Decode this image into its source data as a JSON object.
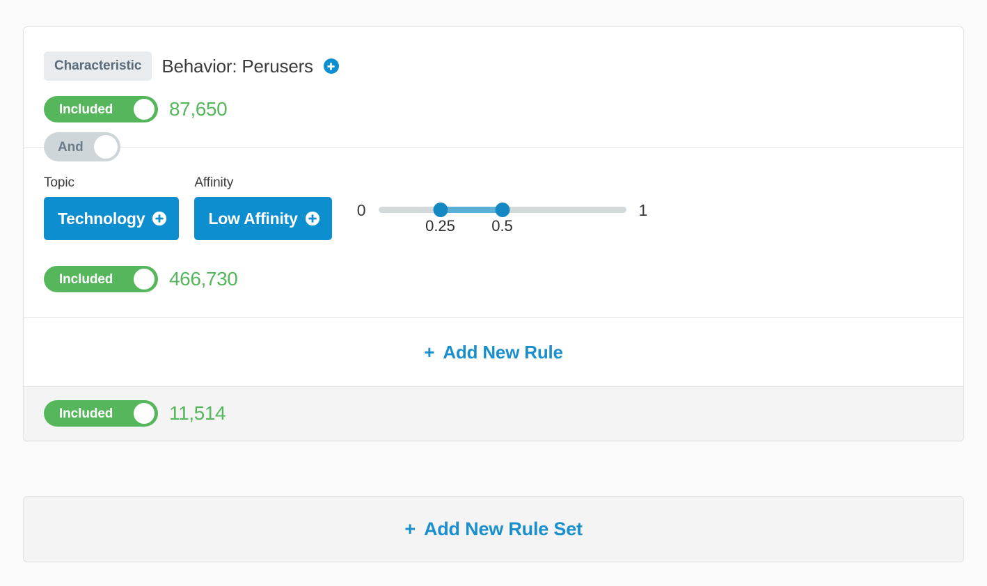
{
  "colors": {
    "page_bg": "#fafafa",
    "card_bg": "#ffffff",
    "card_border": "#dfe3e6",
    "accent_blue": "#0d8ecf",
    "link_blue": "#1a8fcc",
    "included_green": "#56b65b",
    "chip_gray": "#e8ecef",
    "and_gray": "#ced6da",
    "slider_track": "#d4d9dc",
    "slider_fill": "#5bb0d8",
    "slider_handle": "#1588c4",
    "footer_gray": "#f4f4f4"
  },
  "rule_set": {
    "characteristic_rule": {
      "chip_label": "Characteristic",
      "title": "Behavior: Perusers",
      "add_icon": "plus-circle-icon",
      "toggle": {
        "label": "Included",
        "state": "on"
      },
      "count": "87,650"
    },
    "operator": {
      "label": "And",
      "state": "on"
    },
    "topic_rule": {
      "fields": [
        {
          "label": "Topic",
          "value": "Technology",
          "add_icon": "plus-circle-icon"
        },
        {
          "label": "Affinity",
          "value": "Low Affinity",
          "add_icon": "plus-circle-icon"
        }
      ],
      "slider": {
        "min_label": "0",
        "max_label": "1",
        "min": 0,
        "max": 1,
        "low_value": 0.25,
        "high_value": 0.5,
        "low_label": "0.25",
        "high_label": "0.5"
      },
      "toggle": {
        "label": "Included",
        "state": "on"
      },
      "count": "466,730"
    },
    "add_rule": {
      "plus": "+",
      "label": "Add New Rule"
    },
    "footer": {
      "toggle": {
        "label": "Included",
        "state": "on"
      },
      "count": "11,514"
    }
  },
  "add_rule_set": {
    "plus": "+",
    "label": "Add New Rule Set"
  }
}
